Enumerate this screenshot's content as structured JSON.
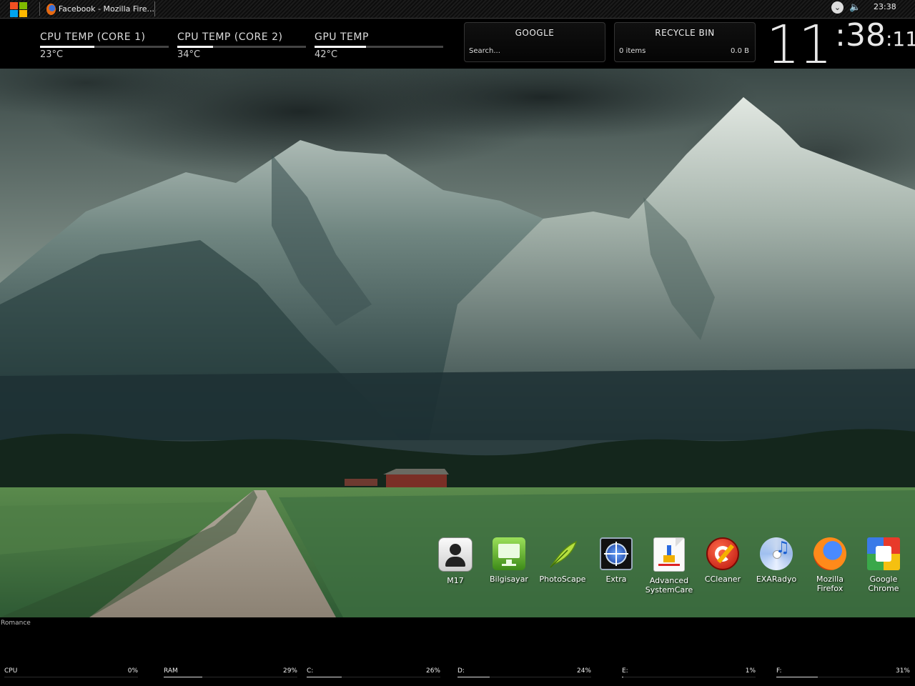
{
  "taskbar": {
    "start_icon": "windows-flag-icon",
    "task_label": "Facebook - Mozilla Fire...",
    "tray_clock": "23:38"
  },
  "sensors": [
    {
      "label": "CPU TEMP (CORE 1)",
      "value": "23°C",
      "level": 0.42
    },
    {
      "label": "CPU TEMP (CORE 2)",
      "value": "34°C",
      "level": 0.28
    },
    {
      "label": "GPU TEMP",
      "value": "42°C",
      "level": 0.4
    }
  ],
  "google": {
    "title": "GOOGLE",
    "placeholder": "Search..."
  },
  "recycle_bin": {
    "title": "RECYCLE BIN",
    "items": "0 items",
    "size": "0.0 B"
  },
  "clock": {
    "hours": "11",
    "minutes": ":38",
    "seconds": ":11"
  },
  "desktop_icons": [
    {
      "label": "M17",
      "icon": "user-contact-icon"
    },
    {
      "label": "Bilgisayar",
      "icon": "monitor-icon"
    },
    {
      "label": "PhotoScape",
      "icon": "feather-icon"
    },
    {
      "label": "Extra",
      "icon": "target-window-icon"
    },
    {
      "label": "Advanced SystemCare",
      "icon": "document-brush-icon"
    },
    {
      "label": "CCleaner",
      "icon": "ccleaner-icon"
    },
    {
      "label": "EXARadyo",
      "icon": "music-cd-icon"
    },
    {
      "label": "Mozilla Firefox",
      "icon": "firefox-icon"
    },
    {
      "label": "Google Chrome",
      "icon": "google-chrome-icon"
    }
  ],
  "now_playing": "Romance",
  "meters": [
    {
      "label": "CPU",
      "value": "0%",
      "level": 0.0
    },
    {
      "label": "RAM",
      "value": "29%",
      "level": 0.29
    },
    {
      "label": "C:",
      "value": "26%",
      "level": 0.26
    },
    {
      "label": "D:",
      "value": "24%",
      "level": 0.24
    },
    {
      "label": "E:",
      "value": "1%",
      "level": 0.01
    },
    {
      "label": "F:",
      "value": "31%",
      "level": 0.31
    }
  ]
}
